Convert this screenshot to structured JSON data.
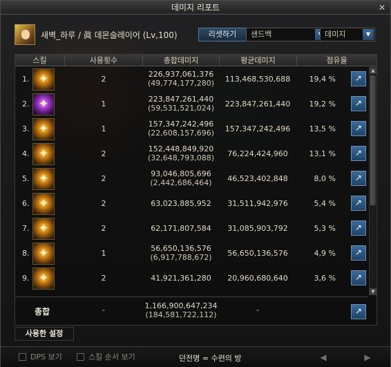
{
  "window": {
    "title": "데미지 리포트",
    "close_label": "✕"
  },
  "character": {
    "name": "새벽_하루 / 眞 데몬슬레이어 (Lv,100)"
  },
  "controls": {
    "reset_label": "리셋하기",
    "target_value": "샌드백",
    "type_value": "데미지"
  },
  "table": {
    "headers": [
      "스킬",
      "사용횟수",
      "총합데미지",
      "평균데미지",
      "점유율"
    ],
    "rows": [
      {
        "rank": "1.",
        "count": "2",
        "total": "226,937,061,376",
        "total_sub": "(49,774,177,280)",
        "avg": "113,468,530,688",
        "share": "19,4  %",
        "icon": "slash-ring-icon"
      },
      {
        "rank": "2.",
        "count": "1",
        "total": "223,847,261,440",
        "total_sub": "(59,531,521,024)",
        "avg": "223,847,261,440",
        "share": "19,2  %",
        "icon": "purple-burst-icon"
      },
      {
        "rank": "3.",
        "count": "1",
        "total": "157,347,242,496",
        "total_sub": "(22,608,157,696)",
        "avg": "157,347,242,496",
        "share": "13,5  %",
        "icon": "flame-slash-icon"
      },
      {
        "rank": "4.",
        "count": "2",
        "total": "152,448,849,920",
        "total_sub": "(32,648,793,088)",
        "avg": "76,224,424,960",
        "share": "13,1  %",
        "icon": "blade-fan-icon"
      },
      {
        "rank": "5.",
        "count": "2",
        "total": "93,046,805,696",
        "total_sub": "(2,442,686,464)",
        "avg": "46,523,402,848",
        "share": "8,0  %",
        "icon": "claw-icon"
      },
      {
        "rank": "6.",
        "count": "2",
        "total": "63,023,885,952",
        "total_sub": "",
        "avg": "31,511,942,976",
        "share": "5,4  %",
        "icon": "dash-figure-icon"
      },
      {
        "rank": "7.",
        "count": "2",
        "total": "62,171,807,584",
        "total_sub": "",
        "avg": "31,085,903,792",
        "share": "5,3  %",
        "icon": "cross-strike-icon"
      },
      {
        "rank": "8.",
        "count": "1",
        "total": "56,650,136,576",
        "total_sub": "(6,917,788,672)",
        "avg": "56,650,136,576",
        "share": "4,9  %",
        "icon": "golden-arc-icon"
      },
      {
        "rank": "9.",
        "count": "2",
        "total": "41,921,361,280",
        "total_sub": "",
        "avg": "20,960,680,640",
        "share": "3,6  %",
        "icon": "wave-slash-icon"
      }
    ],
    "total": {
      "label": "총합",
      "count": "-",
      "total": "1,166,900,647,234",
      "total_sub": "(184,581,722,112)",
      "avg": "-"
    }
  },
  "footer": {
    "used_settings_label": "사용한 설정",
    "dps_label": "DPS 보기",
    "skill_order_label": "스킬 순서 보기",
    "dungeon_label": "던전명 = 수련의 방",
    "prev_icon": "◀",
    "next_icon": "▶"
  }
}
